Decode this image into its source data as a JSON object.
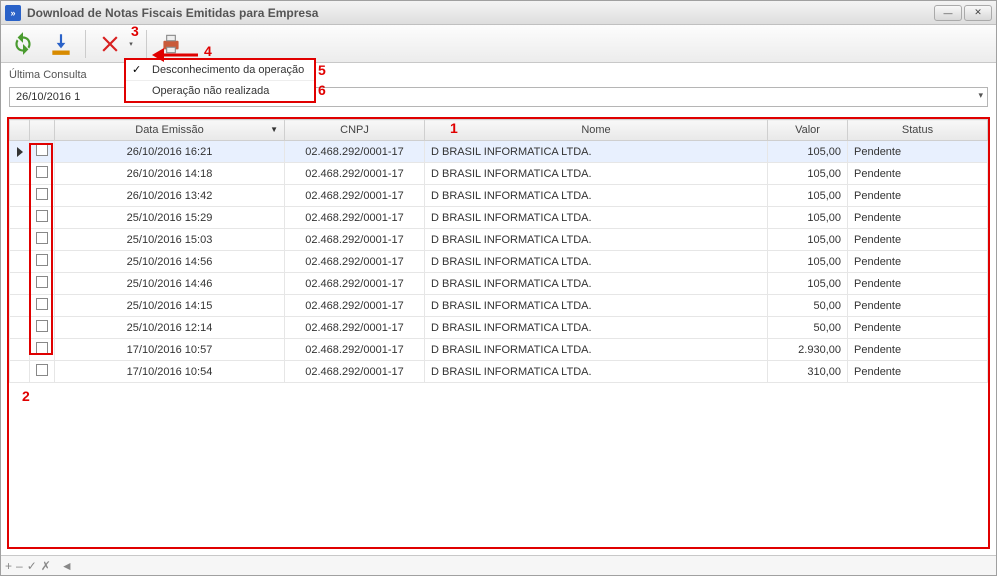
{
  "window": {
    "title": "Download de Notas Fiscais Emitidas para Empresa"
  },
  "toolbar": {
    "refresh": "refresh",
    "download": "download",
    "reject": "reject",
    "print": "print"
  },
  "consulta": {
    "label": "Última Consulta",
    "date": "26/10/2016 1"
  },
  "dropdown": {
    "items": [
      {
        "label": "Desconhecimento da operação",
        "checked": true
      },
      {
        "label": "Operação não realizada",
        "checked": false
      }
    ]
  },
  "columns": {
    "data": "Data Emissão",
    "cnpj": "CNPJ",
    "nome": "Nome",
    "valor": "Valor",
    "status": "Status"
  },
  "rows": [
    {
      "data": "26/10/2016 16:21",
      "cnpj": "02.468.292/0001-17",
      "nome": "D BRASIL INFORMATICA LTDA.",
      "valor": "105,00",
      "status": "Pendente"
    },
    {
      "data": "26/10/2016 14:18",
      "cnpj": "02.468.292/0001-17",
      "nome": "D BRASIL INFORMATICA LTDA.",
      "valor": "105,00",
      "status": "Pendente"
    },
    {
      "data": "26/10/2016 13:42",
      "cnpj": "02.468.292/0001-17",
      "nome": "D BRASIL INFORMATICA LTDA.",
      "valor": "105,00",
      "status": "Pendente"
    },
    {
      "data": "25/10/2016 15:29",
      "cnpj": "02.468.292/0001-17",
      "nome": "D BRASIL INFORMATICA LTDA.",
      "valor": "105,00",
      "status": "Pendente"
    },
    {
      "data": "25/10/2016 15:03",
      "cnpj": "02.468.292/0001-17",
      "nome": "D BRASIL INFORMATICA LTDA.",
      "valor": "105,00",
      "status": "Pendente"
    },
    {
      "data": "25/10/2016 14:56",
      "cnpj": "02.468.292/0001-17",
      "nome": "D BRASIL INFORMATICA LTDA.",
      "valor": "105,00",
      "status": "Pendente"
    },
    {
      "data": "25/10/2016 14:46",
      "cnpj": "02.468.292/0001-17",
      "nome": "D BRASIL INFORMATICA LTDA.",
      "valor": "105,00",
      "status": "Pendente"
    },
    {
      "data": "25/10/2016 14:15",
      "cnpj": "02.468.292/0001-17",
      "nome": "D BRASIL INFORMATICA LTDA.",
      "valor": "50,00",
      "status": "Pendente"
    },
    {
      "data": "25/10/2016 12:14",
      "cnpj": "02.468.292/0001-17",
      "nome": "D BRASIL INFORMATICA LTDA.",
      "valor": "50,00",
      "status": "Pendente"
    },
    {
      "data": "17/10/2016 10:57",
      "cnpj": "02.468.292/0001-17",
      "nome": "D BRASIL INFORMATICA LTDA.",
      "valor": "2.930,00",
      "status": "Pendente"
    },
    {
      "data": "17/10/2016 10:54",
      "cnpj": "02.468.292/0001-17",
      "nome": "D BRASIL INFORMATICA LTDA.",
      "valor": "310,00",
      "status": "Pendente"
    }
  ],
  "annotations": {
    "a1": "1",
    "a2": "2",
    "a3": "3",
    "a4": "4",
    "a5": "5",
    "a6": "6"
  },
  "footer": {
    "plus": "+",
    "minus": "–",
    "check": "✓",
    "cross": "✗",
    "scroll": "◄"
  }
}
